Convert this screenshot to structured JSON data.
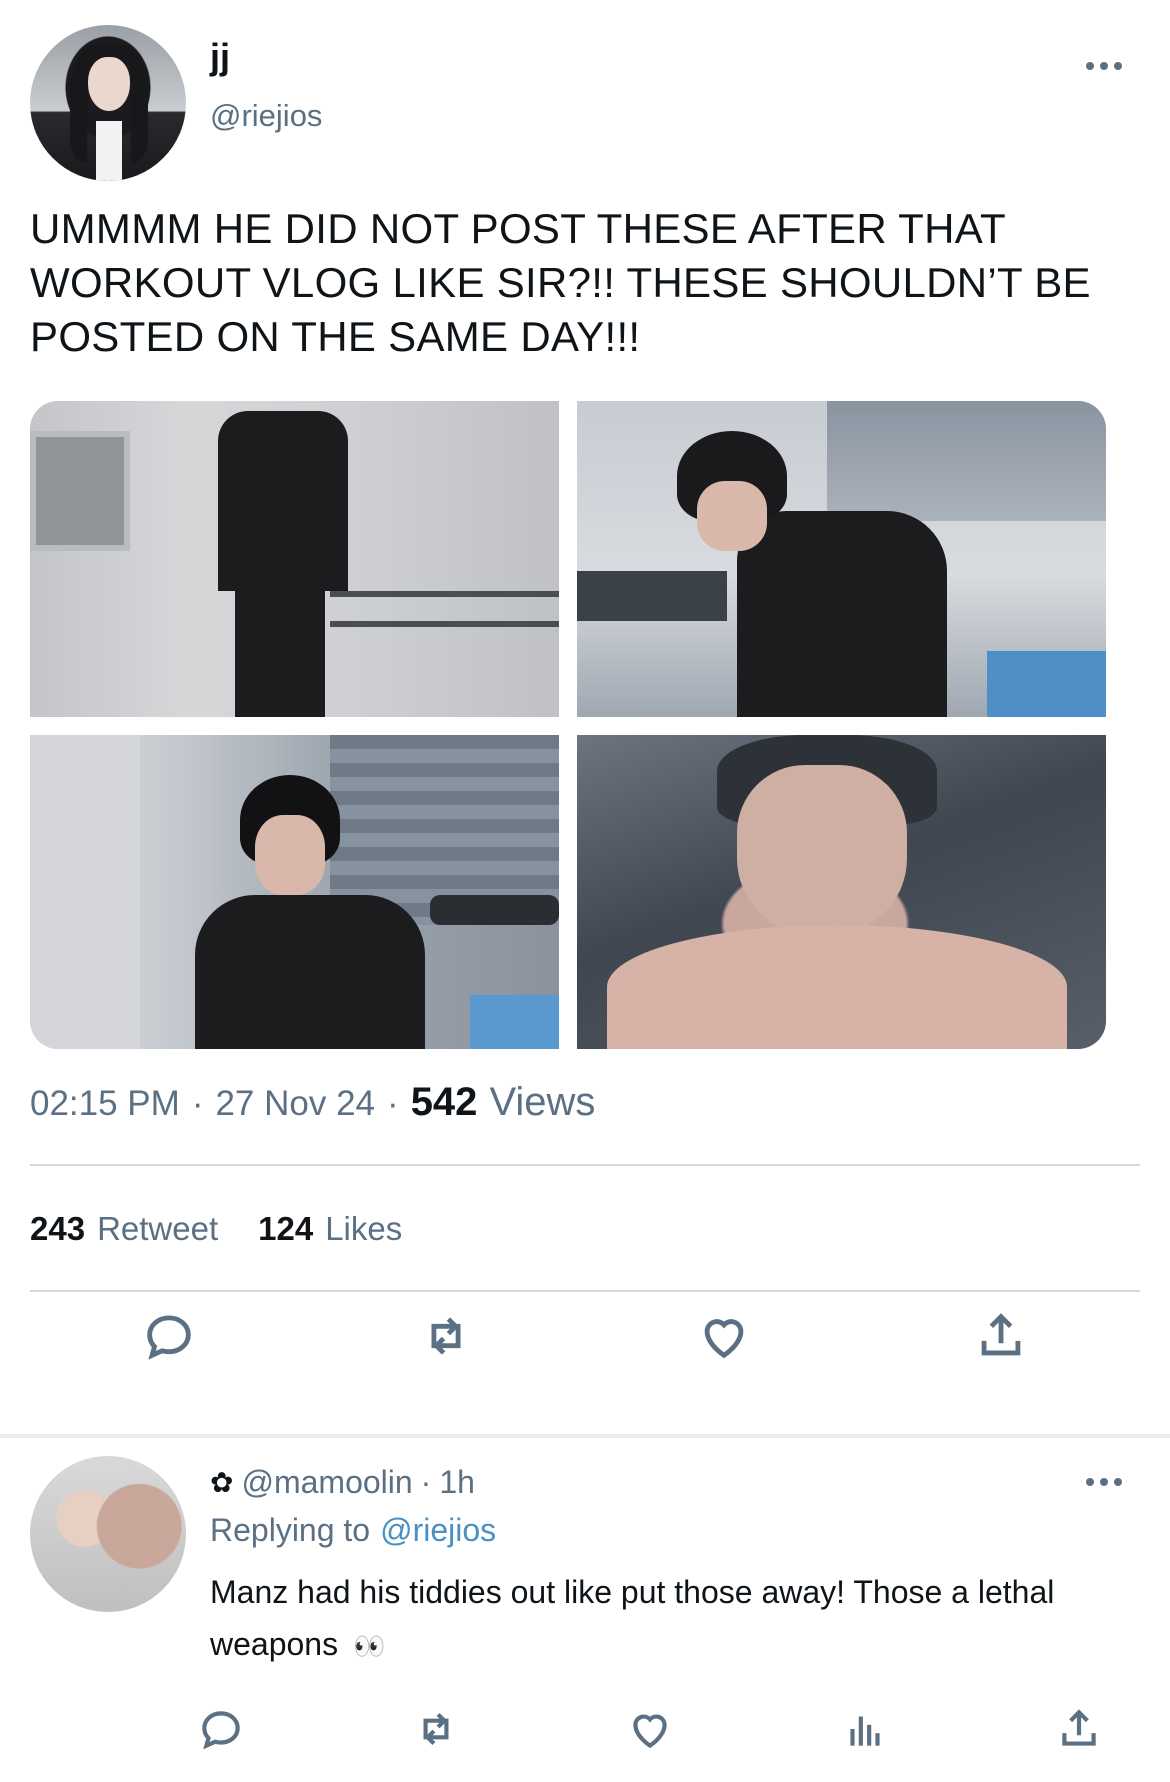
{
  "tweet": {
    "display_name": "jj",
    "handle": "@riejios",
    "text": "UMMMM HE DID NOT POST THESE AFTER THAT WORKOUT VLOG LIKE SIR?!! THESE SHOULDN’T BE POSTED ON THE SAME DAY!!!",
    "time": "02:15 PM",
    "date": "27 Nov 24",
    "separator": "·",
    "views_count": "542",
    "views_label": "Views",
    "retweets_count": "243",
    "retweets_label": "Retweet",
    "likes_count": "124",
    "likes_label": "Likes",
    "icons": [
      "more-icon",
      "reply-icon",
      "retweet-icon",
      "like-icon",
      "share-icon"
    ]
  },
  "reply": {
    "handle": "@mamoolin",
    "time": "1h",
    "separator": "·",
    "replying_label": "Replying to",
    "replying_mention": "@riejios",
    "text": "Manz had his tiddies out like put those away! Those a lethal weapons",
    "emoji": "👀",
    "icons": [
      "flower-icon",
      "more-icon",
      "reply-icon",
      "retweet-icon",
      "like-icon",
      "analytics-icon",
      "share-icon"
    ]
  },
  "colors": {
    "text_primary": "#0f1419",
    "text_secondary": "#5b7083",
    "mention": "#4a90c2",
    "divider": "#cfd9de"
  }
}
